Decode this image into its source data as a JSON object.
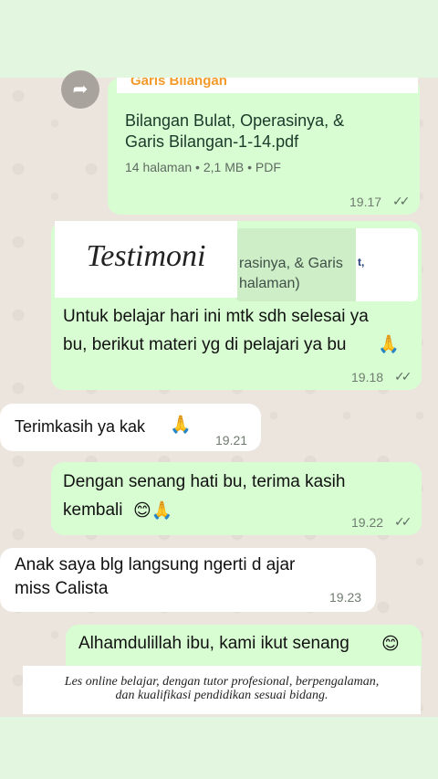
{
  "overlay": {
    "title": "Testimoni",
    "caption_line1": "Les online belajar, dengan tutor profesional, berpengalaman,",
    "caption_line2": "dan kualifikasi pendidikan sesuai bidang."
  },
  "messages": [
    {
      "type": "document",
      "direction": "outgoing",
      "preview_title": "Garis Bilangan",
      "file_name_line1": "Bilangan Bulat, Operasinya, &",
      "file_name_line2": "Garis Bilangan-1-14.pdf",
      "file_meta": "14 halaman • 2,1 MB • PDF",
      "time": "19.17",
      "ticks": "✓✓"
    },
    {
      "type": "reply",
      "direction": "outgoing",
      "quoted_line1": "rasinya, & Garis",
      "quoted_line2": "halaman)",
      "thumb_letter": "t,",
      "text_line1": "Untuk belajar hari ini mtk sdh selesai ya",
      "text_line2": "bu, berikut materi yg di pelajari ya bu",
      "emoji": "🙏",
      "time": "19.18",
      "ticks": "✓✓"
    },
    {
      "type": "text",
      "direction": "incoming",
      "text": "Terimkasih ya kak",
      "emoji": "🙏",
      "time": "19.21"
    },
    {
      "type": "text",
      "direction": "outgoing",
      "text_line1": "Dengan senang hati bu, terima kasih",
      "text_line2": "kembali",
      "emoji": "😊🙏",
      "time": "19.22",
      "ticks": "✓✓"
    },
    {
      "type": "text",
      "direction": "incoming",
      "text_line1": "Anak saya blg langsung ngerti d ajar",
      "text_line2": "miss Calista",
      "time": "19.23"
    },
    {
      "type": "text",
      "direction": "outgoing",
      "text": "Alhamdulillah ibu, kami ikut senang",
      "emoji": "😊"
    }
  ],
  "icons": {
    "forward": "forward-icon"
  },
  "colors": {
    "outgoing_bubble": "#d8fdd2",
    "incoming_bubble": "#ffffff",
    "chat_background": "#ebe5dd",
    "frame_background": "#e3f6df"
  }
}
